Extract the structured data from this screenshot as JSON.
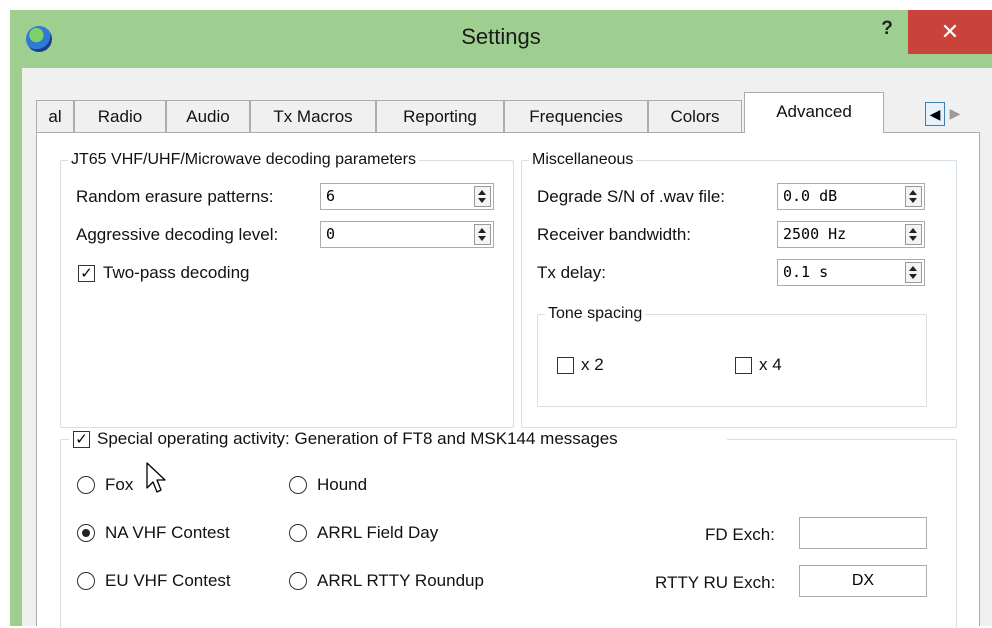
{
  "window": {
    "title": "Settings",
    "help": "?",
    "close": "✕"
  },
  "tabs": [
    "al",
    "Radio",
    "Audio",
    "Tx Macros",
    "Reporting",
    "Frequencies",
    "Colors",
    "Advanced"
  ],
  "tab_scroll": {
    "left": "◀",
    "right": "▶"
  },
  "jt65": {
    "legend": "JT65 VHF/UHF/Microwave decoding parameters",
    "random_erasure_label": "Random erasure patterns:",
    "random_erasure_value": "6",
    "aggressive_label": "Aggressive decoding level:",
    "aggressive_value": "0",
    "two_pass_label": "Two-pass decoding",
    "two_pass_checked": true
  },
  "misc": {
    "legend": "Miscellaneous",
    "degrade_label": "Degrade S/N of .wav file:",
    "degrade_value": "0.0 dB",
    "bandwidth_label": "Receiver bandwidth:",
    "bandwidth_value": "2500 Hz",
    "tx_delay_label": "Tx delay:",
    "tx_delay_value": "0.1 s",
    "tone_spacing": {
      "legend": "Tone spacing",
      "x2_label": "x 2",
      "x4_label": "x 4"
    }
  },
  "special": {
    "legend": "Special operating activity:  Generation of FT8 and MSK144 messages",
    "checked": true,
    "fox": "Fox",
    "hound": "Hound",
    "na_vhf": "NA VHF Contest",
    "arrl_fd": "ARRL Field Day",
    "eu_vhf": "EU VHF Contest",
    "arrl_rtty": "ARRL RTTY Roundup",
    "selected": "NA VHF Contest",
    "fd_exch_label": "FD Exch:",
    "fd_exch_value": "",
    "rtty_exch_label": "RTTY RU Exch:",
    "rtty_exch_value": "DX"
  },
  "colors": {
    "titlebar": "#9fcf90",
    "close": "#c9433a",
    "client": "#f0f0f0"
  }
}
